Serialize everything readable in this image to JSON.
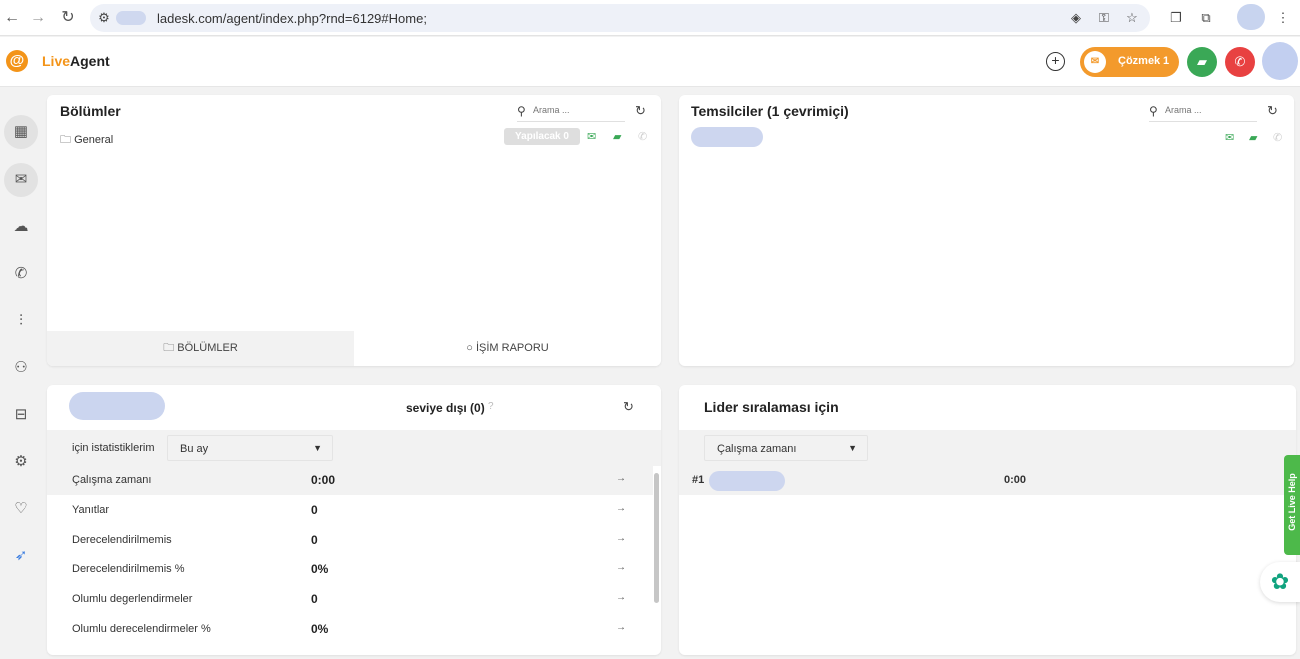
{
  "browser": {
    "url_text": "ladesk.com/agent/index.php?rnd=6129#Home;",
    "back_icon": "←",
    "forward_icon": "→",
    "reload_icon": "↻",
    "site_info_icon": "⚙",
    "lens_icon": "◈",
    "key_icon": "⚿",
    "star_icon": "☆",
    "ext1_icon": "❐",
    "ext2_icon": "⧉",
    "menu_icon": "⋮"
  },
  "header": {
    "logo_mark": "@",
    "logo_live": "Live",
    "logo_agent": "Agent",
    "plus_icon": "+",
    "resolve_label": "Çözmek",
    "resolve_count": "1",
    "resolve_icon": "✉",
    "chat_icon": "▰",
    "phone_icon": "✆"
  },
  "sidebar": {
    "items": [
      {
        "name": "dashboard-icon",
        "glyph": "▦"
      },
      {
        "name": "mail-icon",
        "glyph": "✉"
      },
      {
        "name": "chat-icon",
        "glyph": "☁"
      },
      {
        "name": "phone-icon",
        "glyph": "✆"
      },
      {
        "name": "reports-icon",
        "glyph": "⫶"
      },
      {
        "name": "contacts-icon",
        "glyph": "⚇"
      },
      {
        "name": "knowledgebase-icon",
        "glyph": "⊟"
      },
      {
        "name": "settings-icon",
        "glyph": "⚙"
      },
      {
        "name": "heart-icon",
        "glyph": "♡"
      },
      {
        "name": "rocket-icon",
        "glyph": "➶"
      }
    ]
  },
  "departments": {
    "title": "Bölümler",
    "search_placeholder": "Arama ...",
    "refresh_icon": "↻",
    "folder_icon": "🗀",
    "items": [
      {
        "name": "General",
        "todo_label": "Yapılacak 0"
      }
    ],
    "tabs": {
      "left": "BÖLÜMLER",
      "right": "İŞİM RAPORU"
    }
  },
  "agents": {
    "title": "Temsilciler (1 çevrimiçi)",
    "search_placeholder": "Arama ...",
    "refresh_icon": "↻"
  },
  "stats": {
    "status_text": "seviye dışı (0)",
    "help_icon": "?",
    "refresh_icon": "↻",
    "filter_label": "için istatistiklerim",
    "period_value": "Bu ay",
    "caret_icon": "▼",
    "arrow_icon": "→",
    "rows": [
      {
        "label": "Çalışma zamanı",
        "value": "0:00"
      },
      {
        "label": "Yanıtlar",
        "value": "0"
      },
      {
        "label": "Derecelendirilmemis",
        "value": "0"
      },
      {
        "label": "Derecelendirilmemis %",
        "value": "0%"
      },
      {
        "label": "Olumlu degerlendirmeler",
        "value": "0"
      },
      {
        "label": "Olumlu derecelendirmeler %",
        "value": "0%"
      }
    ]
  },
  "leaderboard": {
    "title": "Lider sıralaması için",
    "metric_value": "Çalışma zamanı",
    "caret_icon": "▼",
    "rows": [
      {
        "rank": "#1",
        "value": "0:00"
      }
    ]
  },
  "widgets": {
    "live_help_label": "Get Live Help",
    "ai_icon": "✿"
  },
  "colors": {
    "accent_orange": "#f39a2c",
    "green": "#3aa856",
    "red": "#e84141"
  }
}
